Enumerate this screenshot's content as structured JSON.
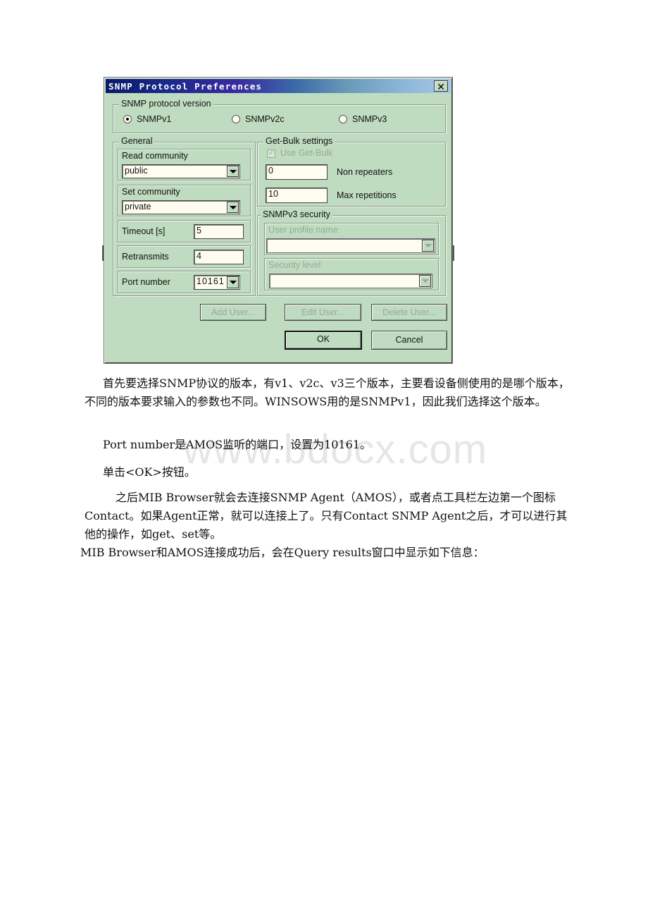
{
  "dialog": {
    "title": "SNMP Protocol Preferences",
    "close_icon": "close-icon",
    "version_group": {
      "legend": "SNMP protocol version",
      "options": [
        {
          "label": "SNMPv1",
          "selected": true
        },
        {
          "label": "SNMPv2c",
          "selected": false
        },
        {
          "label": "SNMPv3",
          "selected": false
        }
      ]
    },
    "general": {
      "legend": "General",
      "read_community": {
        "label": "Read community",
        "value": "public"
      },
      "set_community": {
        "label": "Set community",
        "value": "private"
      },
      "timeout": {
        "label": "Timeout [s]",
        "value": "5"
      },
      "retransmits": {
        "label": "Retransmits",
        "value": "4"
      },
      "port_number": {
        "label": "Port number",
        "value": "10161"
      }
    },
    "get_bulk": {
      "legend": "Get-Bulk settings",
      "use_get_bulk": {
        "label": "Use Get-Bulk",
        "checked": true,
        "enabled": false
      },
      "non_repeaters": {
        "label": "Non repeaters",
        "value": "0"
      },
      "max_repetitions": {
        "label": "Max repetitions",
        "value": "10"
      }
    },
    "v3_security": {
      "legend": "SNMPv3 security",
      "user_profile": {
        "label": "User profile name",
        "value": ""
      },
      "security_level": {
        "label": "Security level",
        "value": ""
      }
    },
    "buttons": {
      "add_user": "Add User...",
      "edit_user": "Edit User...",
      "delete_user": "Delete User...",
      "ok": "OK",
      "cancel": "Cancel"
    }
  },
  "document": {
    "paragraphs": [
      "首先要选择SNMP协议的版本，有v1、v2c、v3三个版本，主要看设备侧使用的是哪个版本，不同的版本要求输入的参数也不同。WINSOWS用的是SNMPv1，因此我们选择这个版本。",
      "Port number是AMOS监听的端口，设置为10161。",
      "单击<OK>按钮。",
      "之后MIB Browser就会去连接SNMP Agent（AMOS），或者点工具栏左边第一个图标Contact。如果Agent正常，就可以连接上了。只有Contact SNMP Agent之后，才可以进行其他的操作，如get、set等。",
      "MIB Browser和AMOS连接成功后，会在Query results窗口中显示如下信息："
    ],
    "watermark": "www.bdocx.com"
  }
}
